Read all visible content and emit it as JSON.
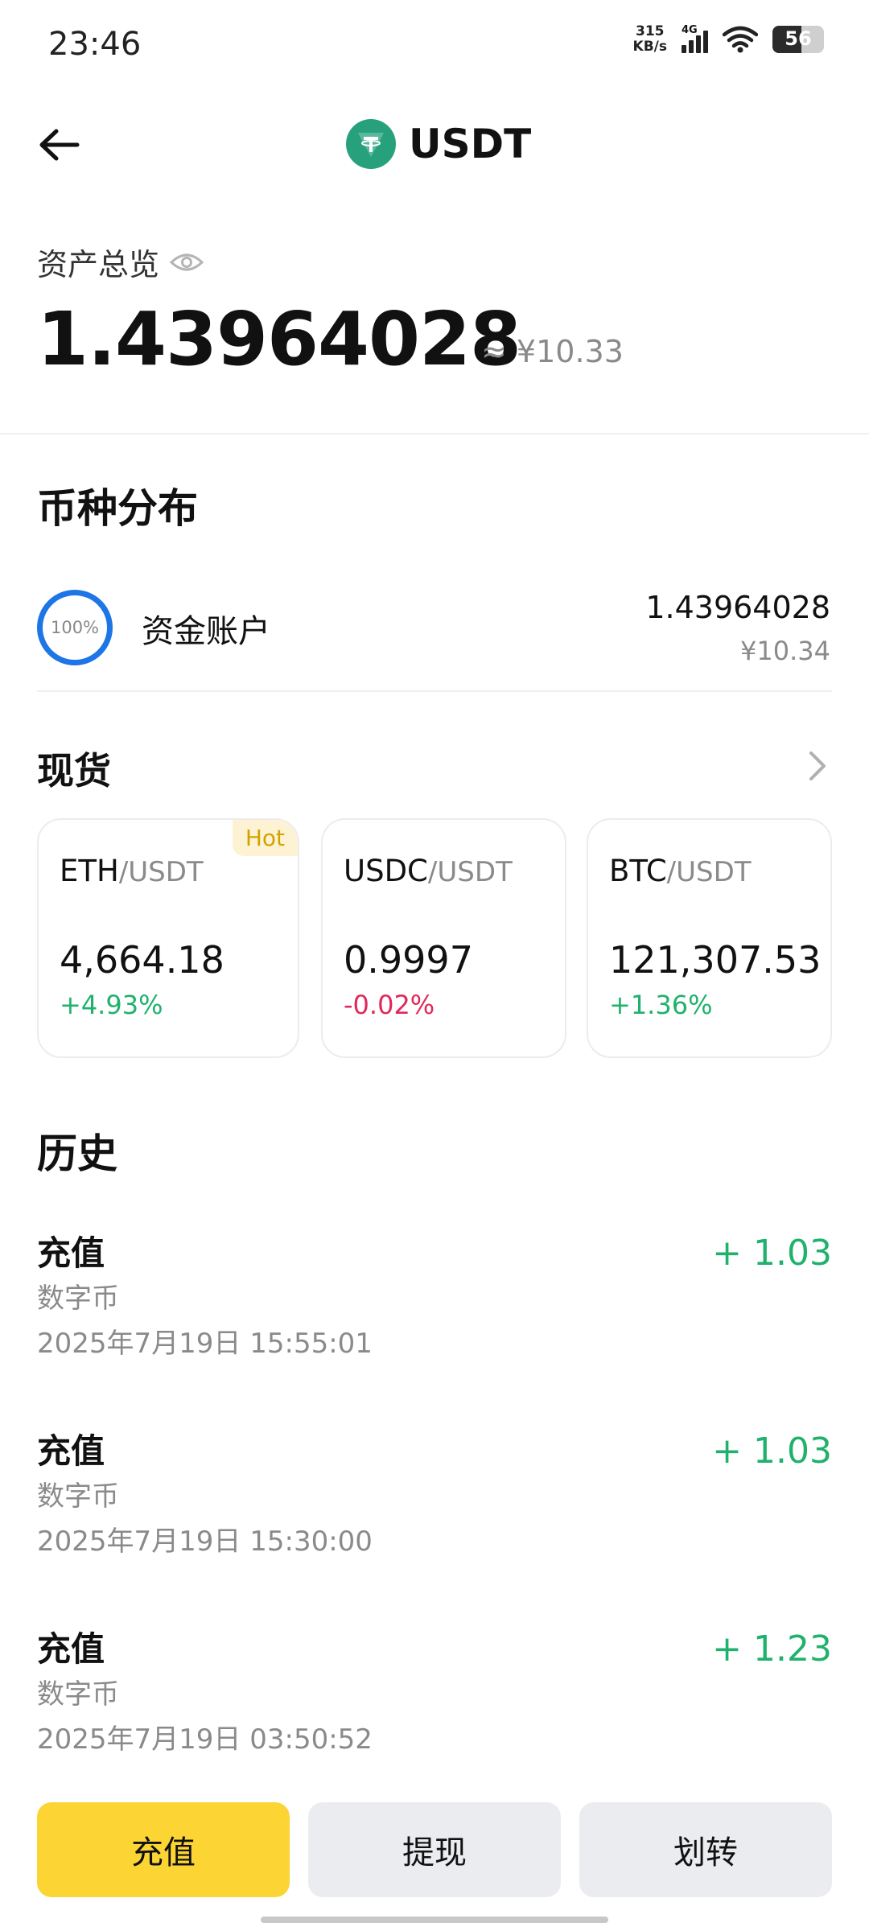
{
  "status_bar": {
    "time": "23:46",
    "net_speed_value": "315",
    "net_speed_unit": "KB/s",
    "network": "4G",
    "battery": "56"
  },
  "header": {
    "title": "USDT",
    "logo_icon": "usdt-tether-icon",
    "logo_color": "#26a17b"
  },
  "overview": {
    "label": "资产总览",
    "amount": "1.43964028",
    "cny": "≈ ¥10.33"
  },
  "distribution": {
    "title": "币种分布",
    "percent_label": "100%",
    "percent": 100,
    "account": "资金账户",
    "amount": "1.43964028",
    "cny": "¥10.34"
  },
  "spot": {
    "title": "现货",
    "cards": [
      {
        "base": "ETH",
        "quote": "/USDT",
        "price": "4,664.18",
        "change": "+4.93%",
        "hot": "Hot"
      },
      {
        "base": "USDC",
        "quote": "/USDT",
        "price": "0.9997",
        "change": "-0.02%"
      },
      {
        "base": "BTC",
        "quote": "/USDT",
        "price": "121,307.53",
        "change": "+1.36%"
      }
    ]
  },
  "history": {
    "title": "历史",
    "items": [
      {
        "type": "充值",
        "sub": "数字币",
        "time": "2025年7月19日 15:55:01",
        "amount": "+ 1.03"
      },
      {
        "type": "充值",
        "sub": "数字币",
        "time": "2025年7月19日 15:30:00",
        "amount": "+ 1.03"
      },
      {
        "type": "充值",
        "sub": "数字币",
        "time": "2025年7月19日 03:50:52",
        "amount": "+ 1.23"
      }
    ]
  },
  "actions": {
    "deposit": "充值",
    "withdraw": "提现",
    "transfer": "划转"
  },
  "colors": {
    "accent_yellow": "#fcd535",
    "up_green": "#20b26c",
    "down_red": "#e0295a",
    "ring_blue": "#1d75e6"
  }
}
